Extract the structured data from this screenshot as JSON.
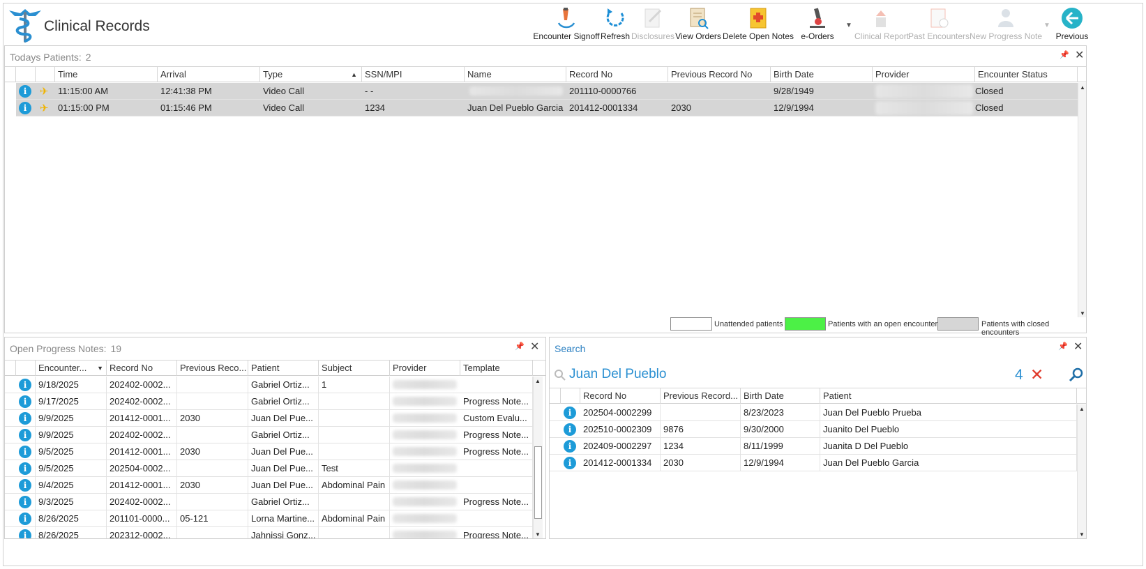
{
  "app": {
    "title": "Clinical Records"
  },
  "toolbar": [
    {
      "label": "Encounter Signoff",
      "icon": "signoff-icon",
      "enabled": true
    },
    {
      "label": "Refresh",
      "icon": "refresh-icon",
      "enabled": true
    },
    {
      "label": "Disclosures",
      "icon": "disclosures-icon",
      "enabled": false
    },
    {
      "label": "View Orders",
      "icon": "view-orders-icon",
      "enabled": true
    },
    {
      "label": "Delete Open Notes",
      "icon": "delete-notes-icon",
      "enabled": true
    },
    {
      "label": "e-Orders",
      "icon": "microscope-icon",
      "enabled": true
    },
    {
      "label": "Clinical Report",
      "icon": "clinical-report-icon",
      "enabled": false
    },
    {
      "label": "Past Encounters",
      "icon": "past-encounters-icon",
      "enabled": false
    },
    {
      "label": "New Progress Note",
      "icon": "new-progress-note-icon",
      "enabled": false
    },
    {
      "label": "Previous",
      "icon": "back-arrow-icon",
      "enabled": true
    }
  ],
  "todays": {
    "title": "Todays Patients:",
    "count": "2",
    "columns": [
      "Time",
      "Arrival",
      "Type",
      "SSN/MPI",
      "Name",
      "Record No",
      "Previous Record No",
      "Birth Date",
      "Provider",
      "Encounter Status"
    ],
    "rows": [
      {
        "time": "11:15:00 AM",
        "arrival": "12:41:38 PM",
        "type": "Video Call",
        "ssn": "-  -",
        "name": "",
        "record": "201110-0000766",
        "prev": "",
        "birth": "9/28/1949",
        "provider": "",
        "status": "Closed"
      },
      {
        "time": "01:15:00 PM",
        "arrival": "01:15:46 PM",
        "type": "Video Call",
        "ssn": "1234",
        "name": "Juan Del Pueblo Garcia",
        "record": "201412-0001334",
        "prev": "2030",
        "birth": "12/9/1994",
        "provider": "",
        "status": "Closed"
      }
    ],
    "legend": [
      {
        "label": "Unattended patients",
        "color": "#ffffff"
      },
      {
        "label": "Patients with an open encounter",
        "color": "#4cf046"
      },
      {
        "label": "Patients with closed encounters",
        "color": "#d6d6d6"
      }
    ]
  },
  "notes": {
    "title": "Open Progress Notes:",
    "count": "19",
    "columns": [
      "Encounter...",
      "Record No",
      "Previous Reco...",
      "Patient",
      "Subject",
      "Provider",
      "Template"
    ],
    "rows": [
      {
        "date": "9/18/2025",
        "record": "202402-0002...",
        "prev": "",
        "patient": "Gabriel Ortiz...",
        "subject": "1",
        "template": ""
      },
      {
        "date": "9/17/2025",
        "record": "202402-0002...",
        "prev": "",
        "patient": "Gabriel Ortiz...",
        "subject": "",
        "template": "Progress Note..."
      },
      {
        "date": "9/9/2025",
        "record": "201412-0001...",
        "prev": "2030",
        "patient": "Juan Del Pue...",
        "subject": "",
        "template": "Custom Evalu..."
      },
      {
        "date": "9/9/2025",
        "record": "202402-0002...",
        "prev": "",
        "patient": "Gabriel Ortiz...",
        "subject": "",
        "template": "Progress Note..."
      },
      {
        "date": "9/5/2025",
        "record": "201412-0001...",
        "prev": "2030",
        "patient": "Juan Del Pue...",
        "subject": "",
        "template": "Progress Note..."
      },
      {
        "date": "9/5/2025",
        "record": "202504-0002...",
        "prev": "",
        "patient": "Juan Del Pue...",
        "subject": "Test",
        "template": ""
      },
      {
        "date": "9/4/2025",
        "record": "201412-0001...",
        "prev": "2030",
        "patient": "Juan Del Pue...",
        "subject": "Abdominal Pain",
        "template": ""
      },
      {
        "date": "9/3/2025",
        "record": "202402-0002...",
        "prev": "",
        "patient": "Gabriel Ortiz...",
        "subject": "",
        "template": "Progress Note..."
      },
      {
        "date": "8/26/2025",
        "record": "201101-0000...",
        "prev": "05-121",
        "patient": "Lorna Martine...",
        "subject": "Abdominal Pain",
        "template": ""
      },
      {
        "date": "8/26/2025",
        "record": "202312-0002...",
        "prev": "",
        "patient": "Jahnissi Gonz...",
        "subject": "",
        "template": "Progress Note..."
      }
    ]
  },
  "search": {
    "title": "Search",
    "query": "Juan Del Pueblo",
    "result_count": "4",
    "columns": [
      "Record No",
      "Previous Record...",
      "Birth Date",
      "Patient"
    ],
    "rows": [
      {
        "record": "202504-0002299",
        "prev": "",
        "birth": "8/23/2023",
        "patient": "Juan Del Pueblo Prueba"
      },
      {
        "record": "202510-0002309",
        "prev": "9876",
        "birth": "9/30/2000",
        "patient": "Juanito Del Pueblo"
      },
      {
        "record": "202409-0002297",
        "prev": "1234",
        "birth": "8/11/1999",
        "patient": "Juanita D Del Pueblo"
      },
      {
        "record": "201412-0001334",
        "prev": "2030",
        "birth": "12/9/1994",
        "patient": "Juan Del Pueblo Garcia"
      }
    ]
  }
}
